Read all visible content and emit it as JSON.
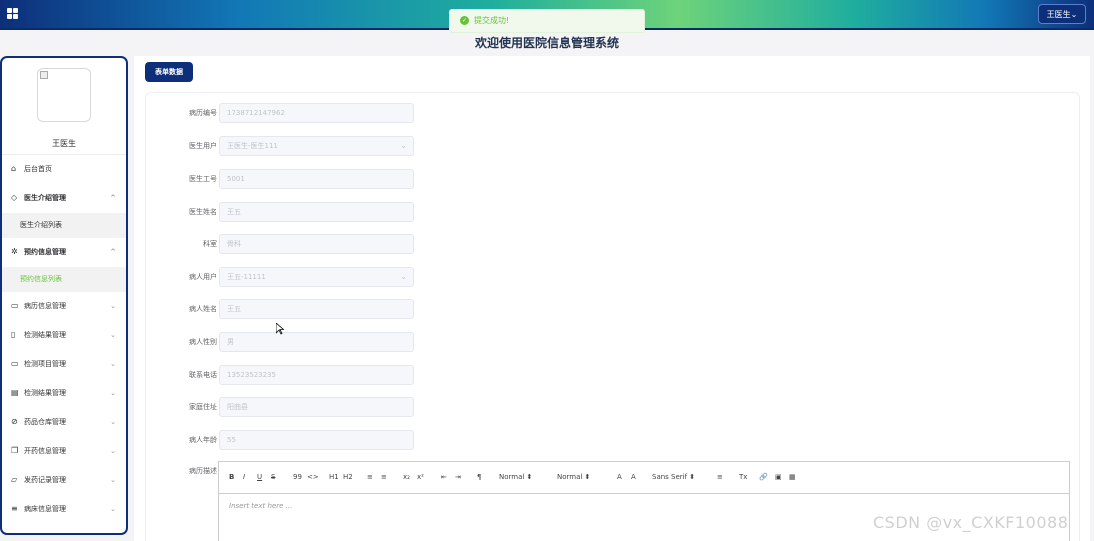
{
  "header": {
    "user_button": "王医生⌄"
  },
  "toast": {
    "message": "提交成功!"
  },
  "page_title": "欢迎使用医院信息管理系统",
  "sidebar": {
    "username": "王医生",
    "items": [
      {
        "label": "后台首页",
        "icon": "home-icon"
      },
      {
        "label": "医生介绍管理",
        "icon": "tag-icon",
        "chevron": "^"
      },
      {
        "label": "医生介绍列表",
        "sub": true
      },
      {
        "label": "预约信息管理",
        "icon": "gear-icon",
        "chevron": "^"
      },
      {
        "label": "预约信息列表",
        "sub": true,
        "active": true
      },
      {
        "label": "病历信息管理",
        "icon": "inbox-icon",
        "chevron": "⌄"
      },
      {
        "label": "检测结果管理",
        "icon": "clipboard-icon",
        "chevron": "⌄"
      },
      {
        "label": "检测项目管理",
        "icon": "message-icon",
        "chevron": "⌄"
      },
      {
        "label": "检测结果管理",
        "icon": "box-icon",
        "chevron": "⌄"
      },
      {
        "label": "药品仓库管理",
        "icon": "paperclip-icon",
        "chevron": "⌄"
      },
      {
        "label": "开药信息管理",
        "icon": "copy-icon",
        "chevron": "⌄"
      },
      {
        "label": "发药记录管理",
        "icon": "bed-icon",
        "chevron": "⌄"
      },
      {
        "label": "病床信息管理",
        "icon": "list-icon",
        "chevron": "⌄"
      }
    ]
  },
  "main": {
    "tab_label": "表单数据",
    "form": [
      {
        "label": "病历编号",
        "value": "1738712147962"
      },
      {
        "label": "医生用户",
        "value": "王医生-医生111",
        "select": true
      },
      {
        "label": "医生工号",
        "value": "5001"
      },
      {
        "label": "医生姓名",
        "value": "王五"
      },
      {
        "label": "科室",
        "value": "骨科"
      },
      {
        "label": "病人用户",
        "value": "王五-11111",
        "select": true
      },
      {
        "label": "病人姓名",
        "value": "王五"
      },
      {
        "label": "病人性别",
        "value": "男"
      },
      {
        "label": "联系电话",
        "value": "13523523235"
      },
      {
        "label": "家庭住址",
        "value": "阳曲县"
      },
      {
        "label": "病人年龄",
        "value": "55"
      },
      {
        "label": "病历描述",
        "value": ""
      }
    ],
    "editor": {
      "placeholder": "Insert text here ...",
      "toolbar": [
        "B",
        "I",
        "U",
        "S",
        "99",
        "<>",
        "H1",
        "H2",
        "≡",
        "≡",
        "x₂",
        "x²",
        "⇤",
        "⇥",
        "¶",
        "Normal ⬍",
        "Normal ⬍",
        "A",
        "A",
        "Sans Serif ⬍",
        "≡",
        "Tx",
        "🔗",
        "▣",
        "▦"
      ]
    }
  },
  "watermark": "CSDN @vx_CXKF10088"
}
